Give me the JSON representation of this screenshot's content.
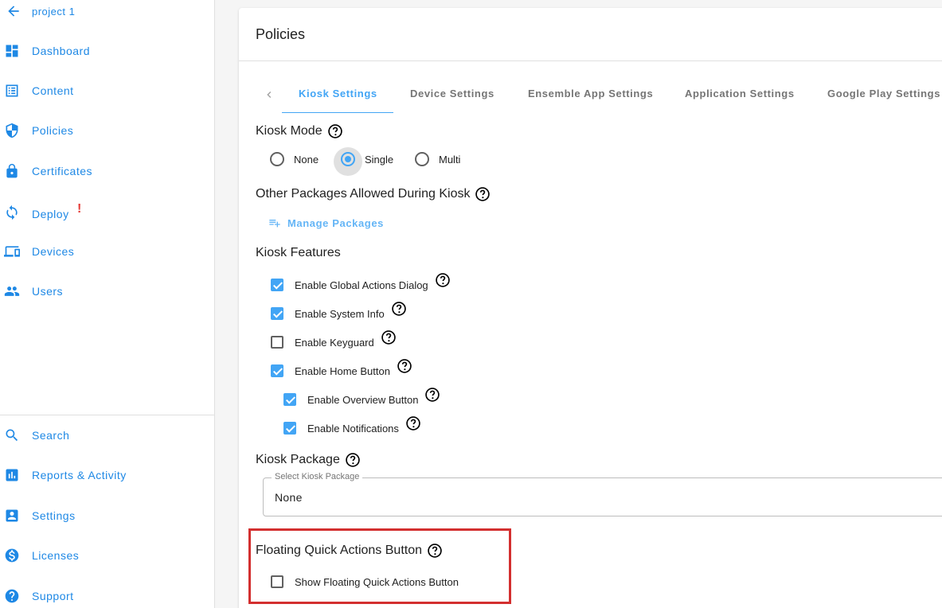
{
  "sidebar": {
    "project": {
      "label": "project 1",
      "icon": "arrow-left-icon"
    },
    "items": [
      {
        "label": "Dashboard",
        "icon": "dashboard-icon"
      },
      {
        "label": "Content",
        "icon": "content-list-icon"
      },
      {
        "label": "Policies",
        "icon": "shield-icon"
      },
      {
        "label": "Certificates",
        "icon": "lock-icon"
      },
      {
        "label": "Deploy",
        "icon": "sync-icon",
        "alert": "!"
      },
      {
        "label": "Devices",
        "icon": "devices-icon"
      },
      {
        "label": "Users",
        "icon": "users-icon"
      }
    ],
    "bottom_items": [
      {
        "label": "Search",
        "icon": "search-icon"
      },
      {
        "label": "Reports & Activity",
        "icon": "bar-chart-icon"
      },
      {
        "label": "Settings",
        "icon": "account-box-icon"
      },
      {
        "label": "Licenses",
        "icon": "dollar-icon"
      },
      {
        "label": "Support",
        "icon": "help-circle-icon"
      }
    ]
  },
  "main": {
    "title": "Policies",
    "tabs": [
      {
        "label": "Kiosk Settings",
        "active": true
      },
      {
        "label": "Device Settings",
        "active": false
      },
      {
        "label": "Ensemble App Settings",
        "active": false
      },
      {
        "label": "Application Settings",
        "active": false
      },
      {
        "label": "Google Play Settings",
        "active": false
      }
    ],
    "kiosk_mode": {
      "heading": "Kiosk Mode",
      "options": [
        {
          "label": "None",
          "checked": false
        },
        {
          "label": "Single",
          "checked": true
        },
        {
          "label": "Multi",
          "checked": false
        }
      ]
    },
    "other_packages": {
      "heading": "Other Packages Allowed During Kiosk",
      "button_label": "Manage Packages"
    },
    "kiosk_features": {
      "heading": "Kiosk Features",
      "items": [
        {
          "label": "Enable Global Actions Dialog",
          "checked": true
        },
        {
          "label": "Enable System Info",
          "checked": true
        },
        {
          "label": "Enable Keyguard",
          "checked": false
        },
        {
          "label": "Enable Home Button",
          "checked": true
        },
        {
          "label": "Enable Overview Button",
          "checked": true
        },
        {
          "label": "Enable Notifications",
          "checked": true
        }
      ]
    },
    "kiosk_package": {
      "heading": "Kiosk Package",
      "select_legend": "Select Kiosk Package",
      "select_value": "None"
    },
    "floating_button": {
      "heading": "Floating Quick Actions Button",
      "checkbox_label": "Show Floating Quick Actions Button",
      "checked": false
    }
  },
  "colors": {
    "accent": "#42a5f5",
    "nav_text": "#1e88e5",
    "alert": "#e53935",
    "highlight": "#d32f2f"
  }
}
